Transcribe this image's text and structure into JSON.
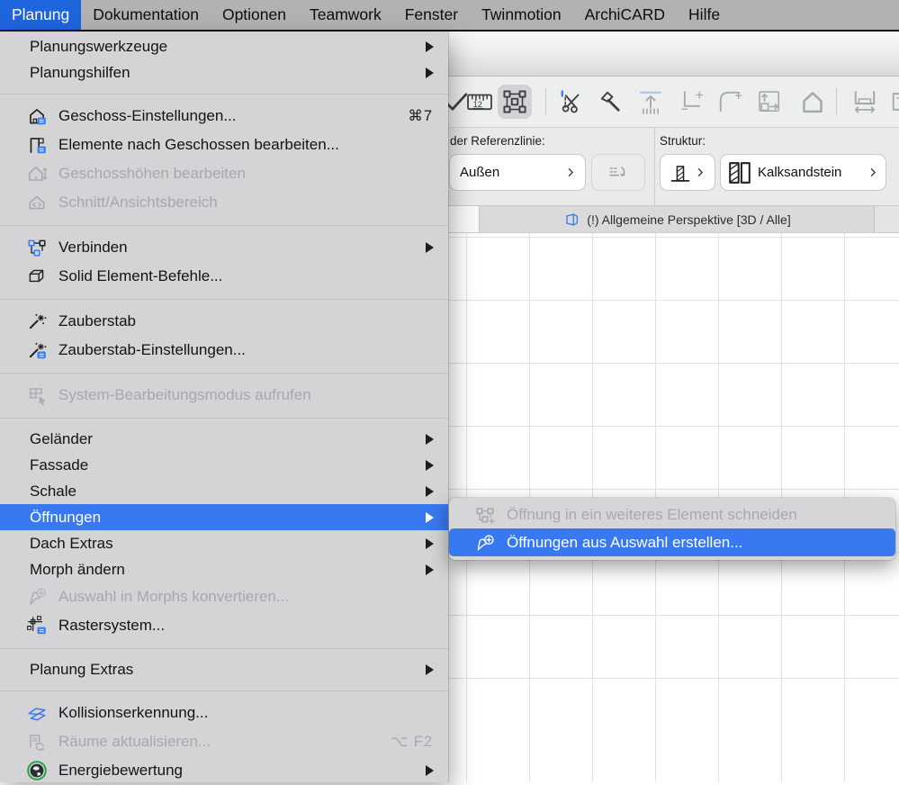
{
  "colors": {
    "accent": "#3b7cf0",
    "menubar_highlight": "#1e65de",
    "selection_blue": "#3878f0",
    "globe_green": "#27a343"
  },
  "menubar": {
    "items": [
      {
        "label": "Planung",
        "selected": true
      },
      {
        "label": "Dokumentation"
      },
      {
        "label": "Optionen"
      },
      {
        "label": "Teamwork"
      },
      {
        "label": "Fenster"
      },
      {
        "label": "Twinmotion"
      },
      {
        "label": "ArchiCARD"
      },
      {
        "label": "Hilfe"
      }
    ]
  },
  "menu": {
    "rows": [
      {
        "label": "Planungswerkzeuge",
        "arrow": true
      },
      {
        "label": "Planungshilfen",
        "arrow": true
      },
      {
        "type": "separator"
      },
      {
        "label": "Geschoss-Einstellungen...",
        "icon": "storey-settings-icon",
        "shortcut": "⌘7"
      },
      {
        "label": "Elemente nach Geschossen bearbeiten...",
        "icon": "edit-elements-by-storey-icon"
      },
      {
        "label": "Geschosshöhen bearbeiten",
        "icon": "storey-heights-icon",
        "disabled": true
      },
      {
        "label": "Schnitt/Ansichtsbereich",
        "icon": "section-viewpoint-icon",
        "disabled": true
      },
      {
        "type": "separator"
      },
      {
        "label": "Verbinden",
        "icon": "connect-icon",
        "arrow": true
      },
      {
        "label": "Solid Element-Befehle...",
        "icon": "solid-element-icon"
      },
      {
        "type": "separator"
      },
      {
        "label": "Zauberstab",
        "icon": "magic-wand-icon"
      },
      {
        "label": "Zauberstab-Einstellungen...",
        "icon": "magic-wand-settings-icon"
      },
      {
        "type": "separator"
      },
      {
        "label": "System-Bearbeitungsmodus aufrufen",
        "icon": "system-edit-mode-icon",
        "disabled": true
      },
      {
        "type": "separator"
      },
      {
        "label": "Geländer",
        "arrow": true
      },
      {
        "label": "Fassade",
        "arrow": true
      },
      {
        "label": "Schale",
        "arrow": true
      },
      {
        "label": "Öffnungen",
        "arrow": true,
        "selected": true
      },
      {
        "label": "Dach Extras",
        "arrow": true
      },
      {
        "label": "Morph ändern",
        "arrow": true
      },
      {
        "label": "Auswahl in Morphs konvertieren...",
        "icon": "convert-to-morph-icon",
        "disabled": true
      },
      {
        "label": "Rastersystem...",
        "icon": "grid-system-icon"
      },
      {
        "type": "separator"
      },
      {
        "label": "Planung Extras",
        "arrow": true
      },
      {
        "type": "separator"
      },
      {
        "label": "Kollisionserkennung...",
        "icon": "collision-detection-icon"
      },
      {
        "label": "Räume aktualisieren...",
        "icon": "update-zones-icon",
        "disabled": true,
        "shortcut": "⌥ F2"
      },
      {
        "label": "Energiebewertung",
        "icon": "energy-evaluation-icon",
        "arrow": true
      }
    ]
  },
  "submenu": {
    "items": [
      {
        "label": "Öffnung in ein weiteres Element schneiden",
        "icon": "cut-opening-icon",
        "disabled": true
      },
      {
        "label": "Öffnungen aus Auswahl erstellen...",
        "icon": "create-openings-icon",
        "selected": true
      }
    ]
  },
  "toolbar": {
    "measure_text": "12",
    "buttons": [
      {
        "icon": "confirm-icon",
        "state": "enabled"
      },
      {
        "icon": "measure-icon",
        "state": "enabled"
      },
      {
        "icon": "marquee-icon",
        "state": "selected"
      },
      {
        "type": "separator"
      },
      {
        "icon": "split-icon",
        "state": "enabled"
      },
      {
        "icon": "adjust-icon",
        "state": "enabled"
      },
      {
        "icon": "elevate-icon",
        "state": "disabled"
      },
      {
        "icon": "intersect-icon",
        "state": "disabled"
      },
      {
        "icon": "fillet-icon",
        "state": "disabled"
      },
      {
        "icon": "resize-icon",
        "state": "disabled"
      },
      {
        "icon": "home-storey-icon",
        "state": "disabled"
      },
      {
        "type": "separator"
      },
      {
        "icon": "stretch-icon",
        "state": "disabled"
      },
      {
        "icon": "edge-icon",
        "state": "disabled"
      }
    ]
  },
  "infobox": {
    "reference_label": "der Referenzlinie:",
    "reference_value": "Außen",
    "structure_label": "Struktur:",
    "structure_material": "Kalksandstein"
  },
  "tab": {
    "title": "(!) Allgemeine Perspektive [3D / Alle]",
    "icon": "3d-view-icon"
  }
}
